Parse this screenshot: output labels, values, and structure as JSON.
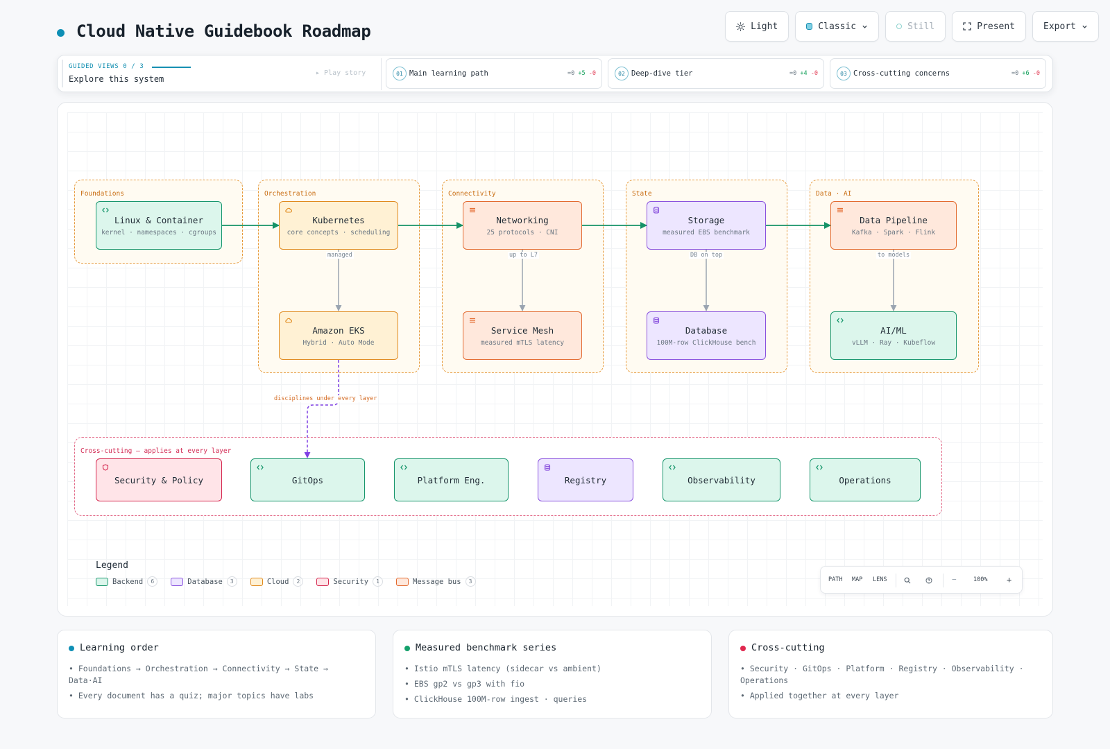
{
  "header": {
    "title": "Cloud Native Guidebook Roadmap",
    "buttons": {
      "light": "Light",
      "classic": "Classic",
      "still": "Still",
      "present": "Present",
      "export": "Export"
    }
  },
  "guided": {
    "label": "GUIDED VIEWS 0 / 3",
    "subtitle": "Explore this system",
    "play": "▸ Play story",
    "views": [
      {
        "num": "01",
        "name": "Main learning path",
        "eq": "=0",
        "plus": "+5",
        "minus": "-0"
      },
      {
        "num": "02",
        "name": "Deep-dive tier",
        "eq": "=0",
        "plus": "+4",
        "minus": "-0"
      },
      {
        "num": "03",
        "name": "Cross-cutting concerns",
        "eq": "=0",
        "plus": "+6",
        "minus": "-0"
      }
    ]
  },
  "diagram": {
    "groups": {
      "foundations": "Foundations",
      "orchestration": "Orchestration",
      "connectivity": "Connectivity",
      "state": "State",
      "data_ai": "Data · AI",
      "cross": "Cross-cutting — applies at every layer"
    },
    "nodes": {
      "linux": {
        "title": "Linux & Container",
        "sub": "kernel · namespaces · cgroups"
      },
      "kubernetes": {
        "title": "Kubernetes",
        "sub": "core concepts · scheduling"
      },
      "networking": {
        "title": "Networking",
        "sub": "25 protocols · CNI"
      },
      "storage": {
        "title": "Storage",
        "sub": "measured EBS benchmark"
      },
      "pipeline": {
        "title": "Data Pipeline",
        "sub": "Kafka · Spark · Flink"
      },
      "eks": {
        "title": "Amazon EKS",
        "sub": "Hybrid · Auto Mode"
      },
      "mesh": {
        "title": "Service Mesh",
        "sub": "measured mTLS latency"
      },
      "database": {
        "title": "Database",
        "sub": "100M-row ClickHouse bench"
      },
      "aiml": {
        "title": "AI/ML",
        "sub": "vLLM · Ray · Kubeflow"
      },
      "security": {
        "title": "Security & Policy"
      },
      "gitops": {
        "title": "GitOps"
      },
      "platform": {
        "title": "Platform Eng."
      },
      "registry": {
        "title": "Registry"
      },
      "observability": {
        "title": "Observability"
      },
      "operations": {
        "title": "Operations"
      }
    },
    "edge_labels": {
      "managed": "managed",
      "up_to_l7": "up to L7",
      "db_on_top": "DB on top",
      "to_models": "to models",
      "disciplines": "disciplines under every layer"
    }
  },
  "legend": {
    "title": "Legend",
    "items": [
      {
        "label": "Backend",
        "count": "6",
        "fill": "#dcf6ec",
        "stroke": "#17966c"
      },
      {
        "label": "Database",
        "count": "3",
        "fill": "#ede6ff",
        "stroke": "#8a52de"
      },
      {
        "label": "Cloud",
        "count": "2",
        "fill": "#fff1d4",
        "stroke": "#e08a1e"
      },
      {
        "label": "Security",
        "count": "1",
        "fill": "#ffe4e8",
        "stroke": "#d5274f"
      },
      {
        "label": "Message bus",
        "count": "3",
        "fill": "#ffe8dc",
        "stroke": "#e36a2f"
      }
    ]
  },
  "controls": {
    "path": "PATH",
    "map": "MAP",
    "lens": "LENS",
    "zoom": "100%",
    "minus": "−",
    "plus": "+"
  },
  "cards": [
    {
      "title": "Learning order",
      "dot": "#0e8fb5",
      "items": [
        "• Foundations → Orchestration → Connectivity → State → Data·AI",
        "• Every document has a quiz; major topics have labs"
      ]
    },
    {
      "title": "Measured benchmark series",
      "dot": "#14a06b",
      "items": [
        "• Istio mTLS latency (sidecar vs ambient)",
        "• EBS gp2 vs gp3 with fio",
        "• ClickHouse 100M-row ingest · queries"
      ]
    },
    {
      "title": "Cross-cutting",
      "dot": "#e0284f",
      "items": [
        "• Security · GitOps · Platform · Registry · Observability · Operations",
        "• Applied together at every layer"
      ]
    }
  ],
  "colors": {
    "accent": "#0e8fb5",
    "edge_main": "#159267",
    "edge_sub": "#9aa4b1",
    "edge_cross": "#7f3fe4"
  }
}
